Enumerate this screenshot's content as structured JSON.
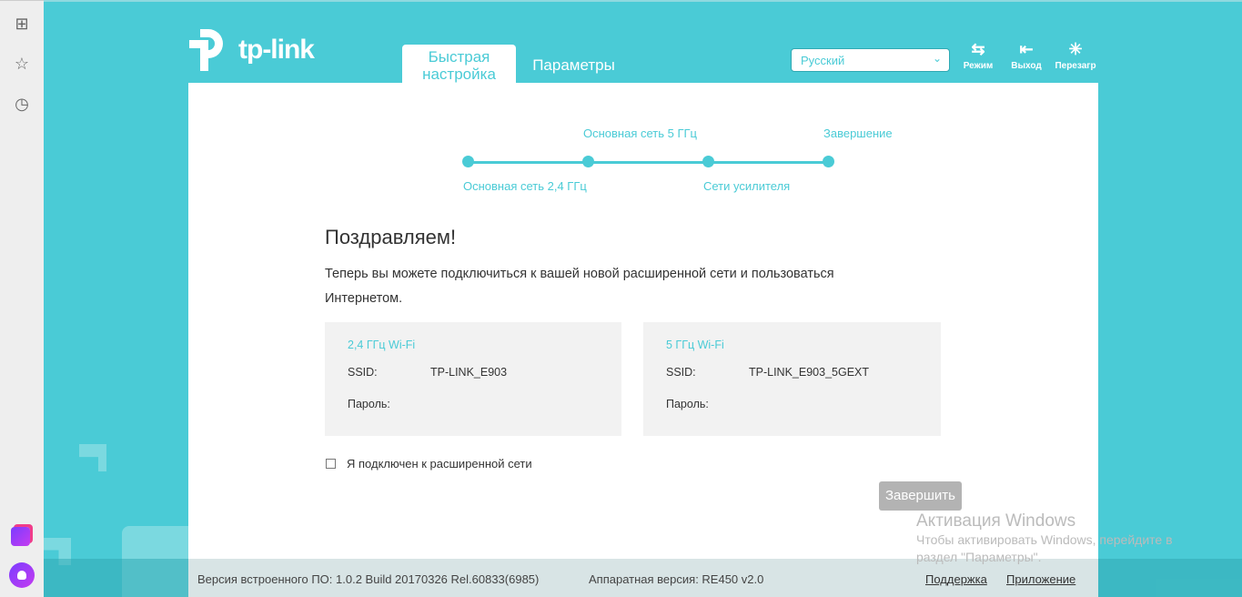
{
  "browser_sidebar": {
    "icons": [
      "apps-grid-icon",
      "star-icon",
      "history-clock-icon",
      "alice-app-icon",
      "alice-assistant-icon"
    ]
  },
  "header": {
    "logo": "tp-link",
    "tabs": [
      {
        "label": "Быстрая настройка",
        "active": true
      },
      {
        "label": "Параметры",
        "active": false
      }
    ],
    "language": "Русский",
    "tools": [
      {
        "label": "Режим",
        "icon": "mode-switch-icon"
      },
      {
        "label": "Выход",
        "icon": "logout-icon"
      },
      {
        "label": "Перезагр",
        "icon": "reboot-icon"
      }
    ]
  },
  "steps": {
    "labels": [
      "Основная сеть 2,4 ГГц",
      "Основная сеть 5 ГГц",
      "Сети усилителя",
      "Завершение"
    ],
    "current": 4
  },
  "main": {
    "title": "Поздравляем!",
    "description": "Теперь вы можете подключиться к вашей новой расширенной сети и пользоваться Интернетом.",
    "cards": [
      {
        "title": "2,4 ГГц Wi-Fi",
        "ssid_label": "SSID:",
        "ssid": "TP-LINK_E903",
        "password_label": "Пароль:",
        "password": ""
      },
      {
        "title": "5 ГГц Wi-Fi",
        "ssid_label": "SSID:",
        "ssid": "TP-LINK_E903_5GEXT",
        "password_label": "Пароль:",
        "password": ""
      }
    ],
    "checkbox_label": "Я подключен к расширенной сети",
    "checkbox_checked": false,
    "finish_button": "Завершить"
  },
  "footer": {
    "firmware": "Версия встроенного ПО: 1.0.2 Build 20170326 Rel.60833(6985)",
    "hardware": "Аппаратная версия: RE450 v2.0",
    "support": "Поддержка",
    "app": "Приложение"
  },
  "watermark": {
    "title": "Активация Windows",
    "text": "Чтобы активировать Windows, перейдите в раздел \"Параметры\"."
  },
  "colors": {
    "accent": "#4acbd6",
    "button_disabled": "#b3b3b3"
  }
}
